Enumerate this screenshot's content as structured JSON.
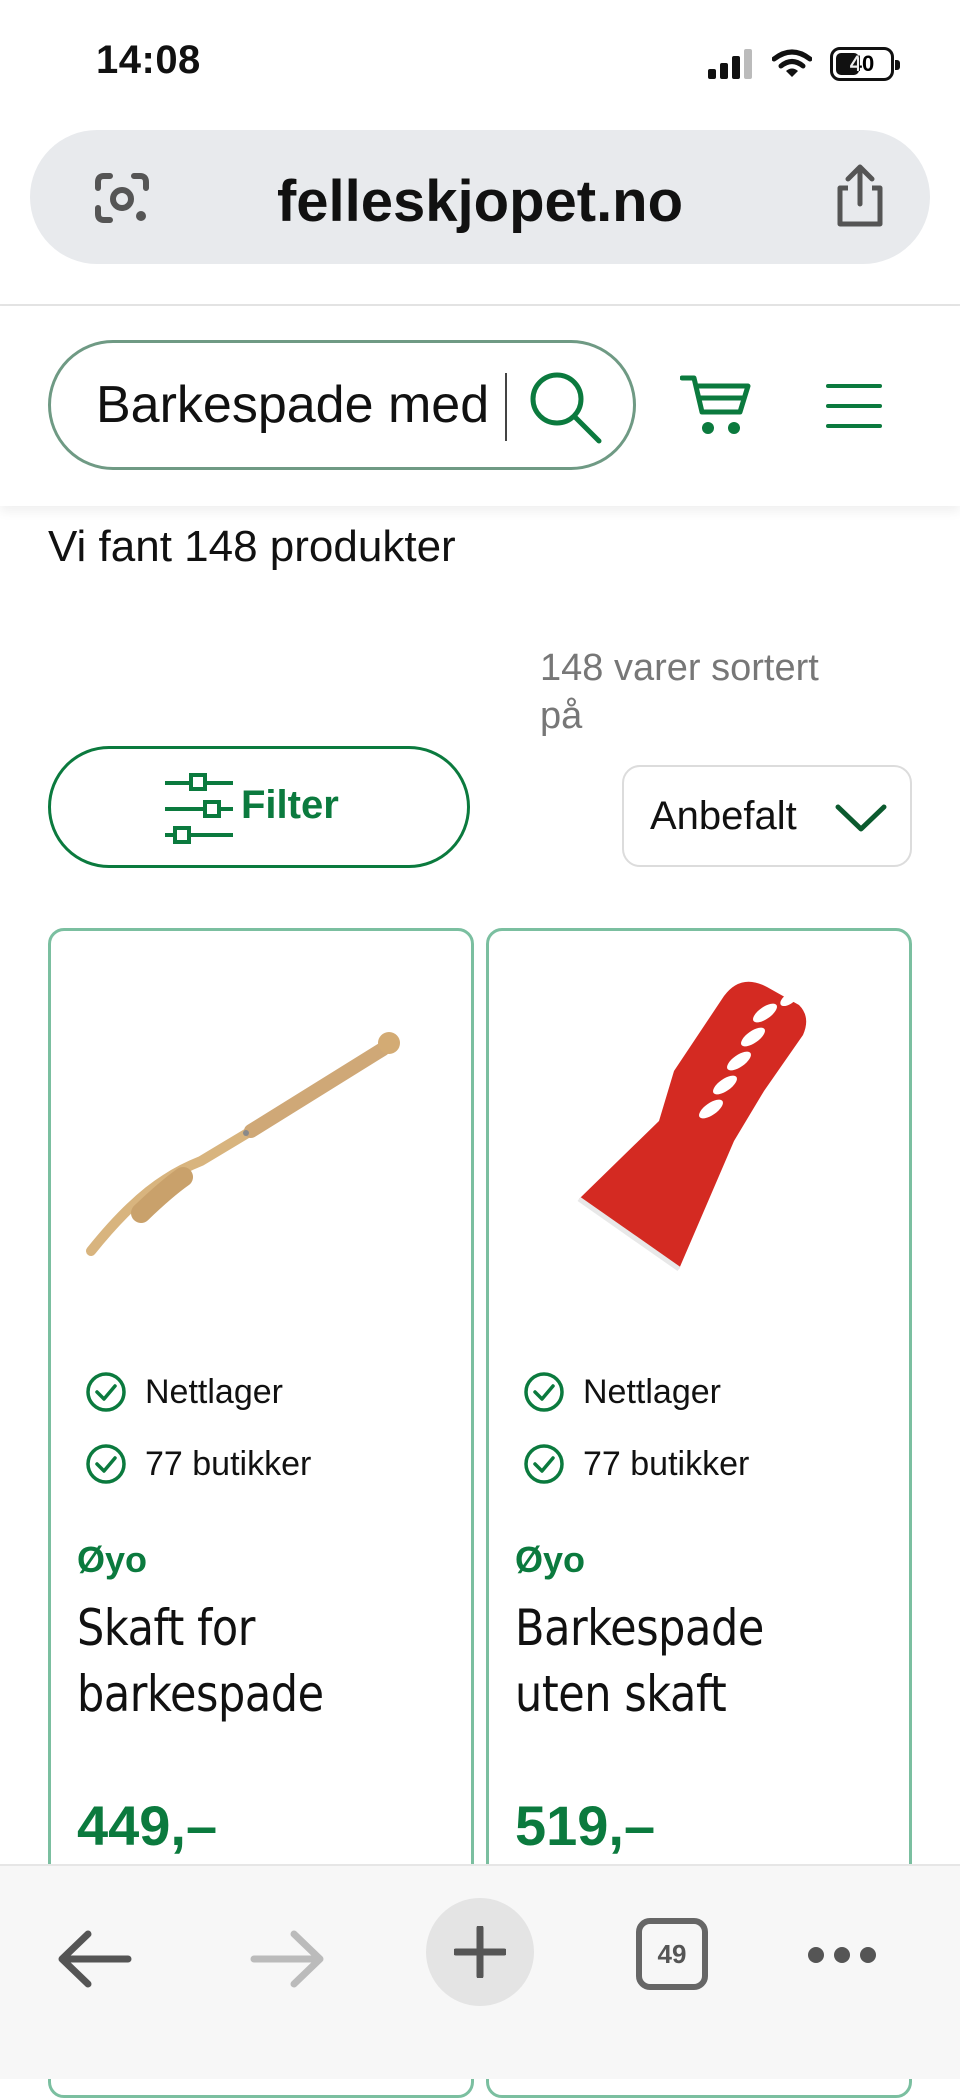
{
  "status_bar": {
    "time": "14:08",
    "battery": "40"
  },
  "browser": {
    "url": "felleskjopet.no",
    "tabs_count": "49"
  },
  "header": {
    "search_value": "Barkespade med"
  },
  "results": {
    "count_text": "Vi fant 148 produkter",
    "sort_info": "148 varer sortert på",
    "filter_label": "Filter",
    "sort_selected": "Anbefalt"
  },
  "products": [
    {
      "availability": [
        "Nettlager",
        "77 butikker"
      ],
      "brand": "Øyo",
      "name": "Skaft for barkespade",
      "price": "449,–"
    },
    {
      "availability": [
        "Nettlager",
        "77 butikker"
      ],
      "brand": "Øyo",
      "name": "Barkespade uten skaft",
      "price": "519,–"
    }
  ],
  "colors": {
    "brand_green": "#0b7a3e",
    "card_border": "#7bbfa0",
    "url_bar": "#e8eaed"
  },
  "icons": [
    "google-lens-icon",
    "share-icon",
    "search-icon",
    "cart-icon",
    "hamburger-menu-icon",
    "filter-sliders-icon",
    "chevron-down-icon",
    "check-circle-icon",
    "back-arrow-icon",
    "forward-arrow-icon",
    "plus-icon",
    "tabs-icon",
    "more-icon"
  ]
}
